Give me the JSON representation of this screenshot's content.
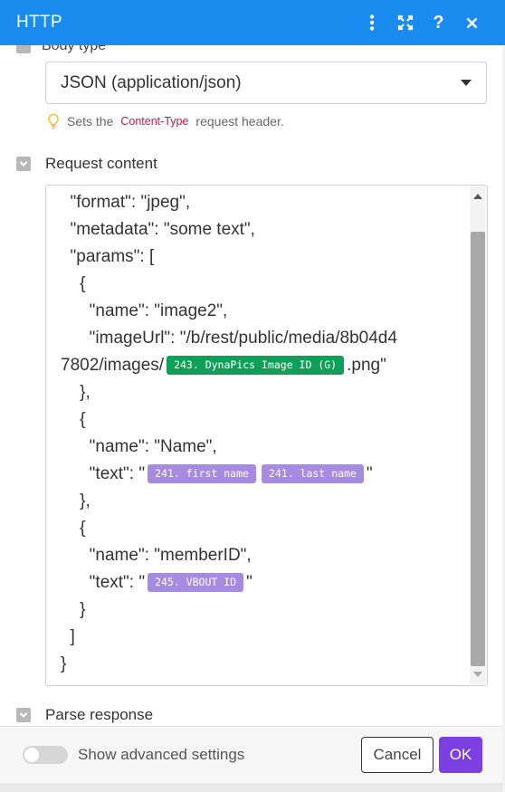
{
  "header": {
    "title": "HTTP",
    "icons": [
      "more-vertical-icon",
      "expand-icon",
      "help-icon",
      "close-icon"
    ],
    "color": "#1a8cf0"
  },
  "body_type": {
    "cut_label": "Body type",
    "selected": "JSON (application/json)"
  },
  "hint": {
    "prefix": "Sets the",
    "code": "Content-Type",
    "suffix": "request header."
  },
  "request_content": {
    "label": "Request content",
    "lines": [
      {
        "indent": "  ",
        "text": "\"format\": \"jpeg\","
      },
      {
        "indent": "  ",
        "text": "\"metadata\": \"some text\","
      },
      {
        "indent": "  ",
        "text": "\"params\": ["
      },
      {
        "indent": "    ",
        "text": "{"
      },
      {
        "indent": "      ",
        "text": "\"name\": \"image2\","
      },
      {
        "indent": "      ",
        "text": "\"imageUrl\": \"/b/rest/public/media/8b04d4"
      },
      {
        "indent": "",
        "text": "7802/images/",
        "pill": {
          "label": "243. DynaPics Image ID (G)",
          "color": "green"
        },
        "after": ".png\""
      },
      {
        "indent": "    ",
        "text": "},"
      },
      {
        "indent": "    ",
        "text": "{"
      },
      {
        "indent": "      ",
        "text": "\"name\": \"Name\","
      },
      {
        "indent": "      ",
        "text": "\"text\": \"",
        "pills": [
          {
            "label": "241. first name",
            "color": "purple"
          },
          {
            "label": "241. last name",
            "color": "purple"
          }
        ],
        "after": "\""
      },
      {
        "indent": "    ",
        "text": "},"
      },
      {
        "indent": "    ",
        "text": "{"
      },
      {
        "indent": "      ",
        "text": "\"name\": \"memberID\","
      },
      {
        "indent": "      ",
        "text": "\"text\": \"",
        "pill": {
          "label": "245. VBOUT ID",
          "color": "purple"
        },
        "after": "\""
      },
      {
        "indent": "    ",
        "text": "}"
      },
      {
        "indent": "  ",
        "text": "]"
      },
      {
        "indent": "",
        "text": "}"
      }
    ],
    "pill_colors": {
      "green": "#0f9f58",
      "purple": "#a78be0"
    }
  },
  "parse_response": {
    "label": "Parse response"
  },
  "footer": {
    "advanced_label": "Show advanced settings",
    "cancel_label": "Cancel",
    "ok_label": "OK",
    "ok_color": "#7b3fe4"
  }
}
